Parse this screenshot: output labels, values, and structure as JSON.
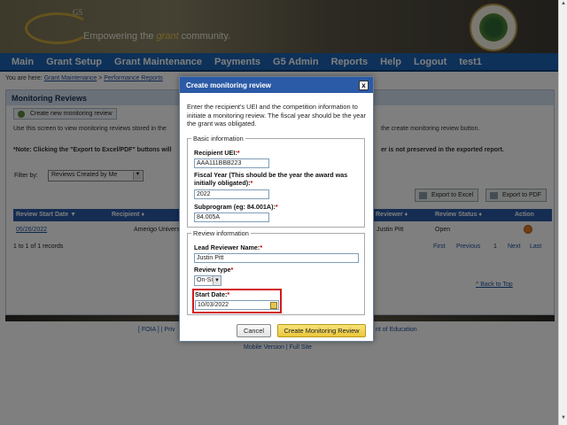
{
  "banner": {
    "logo_mark": "G5",
    "tagline_pre": "Empowering the ",
    "tagline_accent": "grant",
    "tagline_post": " community."
  },
  "nav": {
    "items": [
      "Main",
      "Grant Setup",
      "Grant Maintenance",
      "Payments",
      "G5 Admin",
      "Reports",
      "Help",
      "Logout",
      "test1"
    ]
  },
  "breadcrumb": {
    "prefix": "You are here: ",
    "crumb1": "Grant Maintenance",
    "sep": " > ",
    "crumb2": "Performance Reports"
  },
  "panel": {
    "title": "Monitoring Reviews",
    "create_label": "Create new monitoring review",
    "para1": "Use this screen to view monitoring reviews stored in the",
    "para1_right": "the create monitoring review button.",
    "note_left": "*Note: Clicking the \"Export to Excel/PDF\" buttons will",
    "note_right": "er is not preserved in the exported report.",
    "filter_label": "Filter by:",
    "filter_value": "Reviews Created by Me",
    "export_excel": "Export to Excel",
    "export_pdf": "Export to PDF"
  },
  "table": {
    "headers": {
      "start": "Review Start Date ▼",
      "recipient": "Recipient ♦",
      "reviewer": "Reviewer ♦",
      "status": "Review Status ♦",
      "action": "Action"
    },
    "row": {
      "start": "05/26/2022",
      "recipient": "Amerigo University",
      "reviewer": "Justin Pitt",
      "status": "Open"
    },
    "records": "1 to 1 of 1 records",
    "pager": {
      "first": "First",
      "previous": "Previous",
      "page": "1",
      "next": "Next",
      "last": "Last"
    },
    "back_top": "^ Back to Top"
  },
  "footer": {
    "left": "[ FOIA ] | Priv",
    "right": "nt of Education",
    "mobile": "Mobile Version | Full Site"
  },
  "dialog": {
    "title": "Create monitoring review",
    "close": "x",
    "intro": "Enter the recipient's UEI and the competition information to initiate a monitoring review. The fiscal year should be the year the grant was obligated.",
    "basic_legend": "Basic information",
    "uei_label": "Recipient UEI:",
    "uei_value": "AAA111BBB223",
    "fy_label": "Fiscal Year (This should be the year the award was initially obligated):",
    "fy_value": "2022",
    "subprogram_label": "Subprogram (eg: 84.001A):",
    "subprogram_value": "84.005A",
    "review_legend": "Review information",
    "lead_label": "Lead Reviewer Name:",
    "lead_value": "Justin Pitt",
    "type_label": "Review type",
    "type_value": "On-Site",
    "start_label": "Start Date:",
    "start_value": "10/03/2022",
    "required_mark": "*",
    "cancel": "Cancel",
    "create": "Create Monitoring Review"
  },
  "colors": {
    "nav": "#1a62b3",
    "dialog_title": "#2b5aa6",
    "highlight": "#d11a1a",
    "primary_button": "#ebc73a"
  }
}
